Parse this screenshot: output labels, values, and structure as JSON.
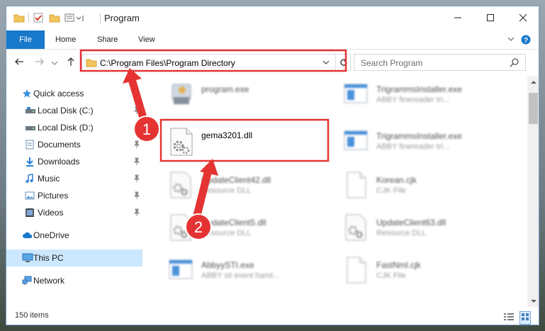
{
  "window": {
    "title": "Program"
  },
  "ribbon": {
    "tabs": [
      "File",
      "Home",
      "Share",
      "View"
    ]
  },
  "address": {
    "path": "C:\\Program Files\\Program Directory"
  },
  "search": {
    "placeholder": "Search Program"
  },
  "nav_pane": {
    "quick_access": "Quick access",
    "pinned": [
      {
        "label": "Local Disk (C:)",
        "icon": "drive-icon"
      },
      {
        "label": "Local Disk (D:)",
        "icon": "drive-icon"
      },
      {
        "label": "Documents",
        "icon": "documents-icon"
      },
      {
        "label": "Downloads",
        "icon": "downloads-icon"
      },
      {
        "label": "Music",
        "icon": "music-icon"
      },
      {
        "label": "Pictures",
        "icon": "pictures-icon"
      },
      {
        "label": "Videos",
        "icon": "videos-icon"
      }
    ],
    "onedrive": "OneDrive",
    "this_pc": "This PC",
    "network": "Network"
  },
  "files": [
    {
      "name": "program.exe",
      "desc": "",
      "icon": "installer-icon"
    },
    {
      "name": "TrigrammsInstaller.exe",
      "desc": "ABBY finereader tri...",
      "icon": "app-window-icon"
    },
    {
      "name": "gema3201.dll",
      "desc": "",
      "icon": "dll-gear-icon"
    },
    {
      "name": "TrigrammsInstaller.exe",
      "desc": "ABBY finereader tri...",
      "icon": "app-window-icon"
    },
    {
      "name": "UpdateClient42.dll",
      "desc": "Resource DLL",
      "icon": "dll-gear-icon"
    },
    {
      "name": "Korean.cjk",
      "desc": "CJK File",
      "icon": "blank-file-icon"
    },
    {
      "name": "UpdateClient5.dll",
      "desc": "Resource DLL",
      "icon": "dll-gear-icon"
    },
    {
      "name": "UpdateClient63.dll",
      "desc": "Resource DLL",
      "icon": "dll-gear-icon"
    },
    {
      "name": "AbbyySTI.exe",
      "desc": "ABBY sti event hand...",
      "icon": "app-window-icon"
    },
    {
      "name": "FastNml.cjk",
      "desc": "CJK File",
      "icon": "blank-file-icon"
    }
  ],
  "status": {
    "item_count": "150 items"
  },
  "annotations": {
    "step1": "1",
    "step2": "2"
  },
  "colors": {
    "accent": "#1979ca",
    "highlight": "#e53333",
    "selected": "#cce8ff"
  }
}
